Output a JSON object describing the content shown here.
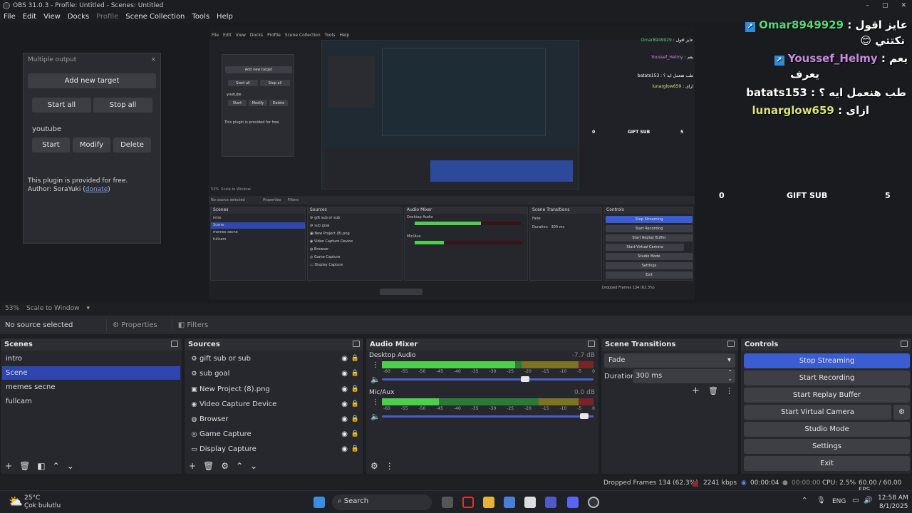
{
  "window": {
    "title": "OBS 31.0.3 - Profile: Untitled - Scenes: Untitled",
    "min": "–",
    "max": "▢",
    "close": "✕"
  },
  "menu": [
    "File",
    "Edit",
    "View",
    "Docks",
    "Profile",
    "Scene Collection",
    "Tools",
    "Help"
  ],
  "multi_output": {
    "title": "Multiple output",
    "close": "×",
    "add_target": "Add new target",
    "start_all": "Start all",
    "stop_all": "Stop all",
    "target_name": "youtube",
    "start": "Start",
    "modify": "Modify",
    "delete": "Delete",
    "note1": "This plugin is provided for free.",
    "note2_prefix": "Author: SoraYuki (",
    "donate": "donate",
    "note2_suffix": ")"
  },
  "chat": [
    {
      "name": "Omar8949929",
      "msg": "عايز اقول",
      "emoji": "😊",
      "line2": "نكتتي"
    },
    {
      "name": "Youssef_Helmy",
      "msg": "يعم",
      "line2": "يعرف"
    },
    {
      "name": "batats153",
      "msg": "طب هنعمل ايه ؟"
    },
    {
      "name": "lunarglow659",
      "msg": "ازاى"
    }
  ],
  "gift_sub": {
    "left": "0",
    "label": "GIFT SUB",
    "right": "5"
  },
  "scale": {
    "zoom": "53%",
    "mode": "Scale to Window"
  },
  "source_bar": {
    "no_source": "No source selected",
    "properties": "Properties",
    "filters": "Filters"
  },
  "scenes": {
    "title": "Scenes",
    "items": [
      "intro",
      "Scene",
      "memes secne",
      "fullcam"
    ],
    "selected": 1
  },
  "sources": {
    "title": "Sources",
    "items": [
      {
        "name": "gift sub or sub",
        "icon": "⚙"
      },
      {
        "name": "sub goal",
        "icon": "⚙"
      },
      {
        "name": "New Project (8).png",
        "icon": "▣"
      },
      {
        "name": "Video Capture Device",
        "icon": "◉"
      },
      {
        "name": "Browser",
        "icon": "◍"
      },
      {
        "name": "Game Capture",
        "icon": "◎"
      },
      {
        "name": "Display Capture",
        "icon": "▭"
      }
    ]
  },
  "mixer": {
    "title": "Audio Mixer",
    "channels": [
      {
        "name": "Desktop Audio",
        "db": "-7.7 dB",
        "level": 0.63,
        "volume": 0.69
      },
      {
        "name": "Mic/Aux",
        "db": "0.0 dB",
        "level": 0.27,
        "volume": 0.97
      }
    ],
    "ticks": [
      "-60",
      "-55",
      "-50",
      "-45",
      "-40",
      "-35",
      "-30",
      "-25",
      "-20",
      "-15",
      "-10",
      "-5",
      "0"
    ]
  },
  "transitions": {
    "title": "Scene Transitions",
    "type": "Fade",
    "duration_label": "Duration",
    "duration": "300 ms"
  },
  "controls": {
    "title": "Controls",
    "stop_streaming": "Stop Streaming",
    "start_recording": "Start Recording",
    "start_replay": "Start Replay Buffer",
    "start_virtual": "Start Virtual Camera",
    "studio_mode": "Studio Mode",
    "settings": "Settings",
    "exit": "Exit"
  },
  "status": {
    "dropped": "Dropped Frames 134 (62.3%)",
    "kbps": "2241 kbps",
    "stream_time": "00:00:04",
    "rec_time": "00:00:00",
    "cpu": "CPU: 2.5%",
    "fps": "60.00 / 60.00 FPS"
  },
  "taskbar": {
    "temp": "25°C",
    "weather": "Çok bulutlu",
    "search": "Search",
    "lang": "ENG",
    "time": "12:58 AM",
    "date": "8/1/2025"
  },
  "nested": {
    "title": "OBS 31.0.3 - Profile: Untitled - Scenes: Untitled",
    "scenes": [
      "intro",
      "Scene",
      "memes secne",
      "fullcam"
    ],
    "sources": [
      "gift sub or sub",
      "sub goal",
      "New Project (8).png",
      "Video Capture Device",
      "Browser",
      "Game Capture",
      "Display Capture"
    ],
    "controls": [
      "Stop Streaming",
      "Start Recording",
      "Start Replay Buffer",
      "Start Virtual Camera",
      "Studio Mode",
      "Settings",
      "Exit"
    ]
  }
}
